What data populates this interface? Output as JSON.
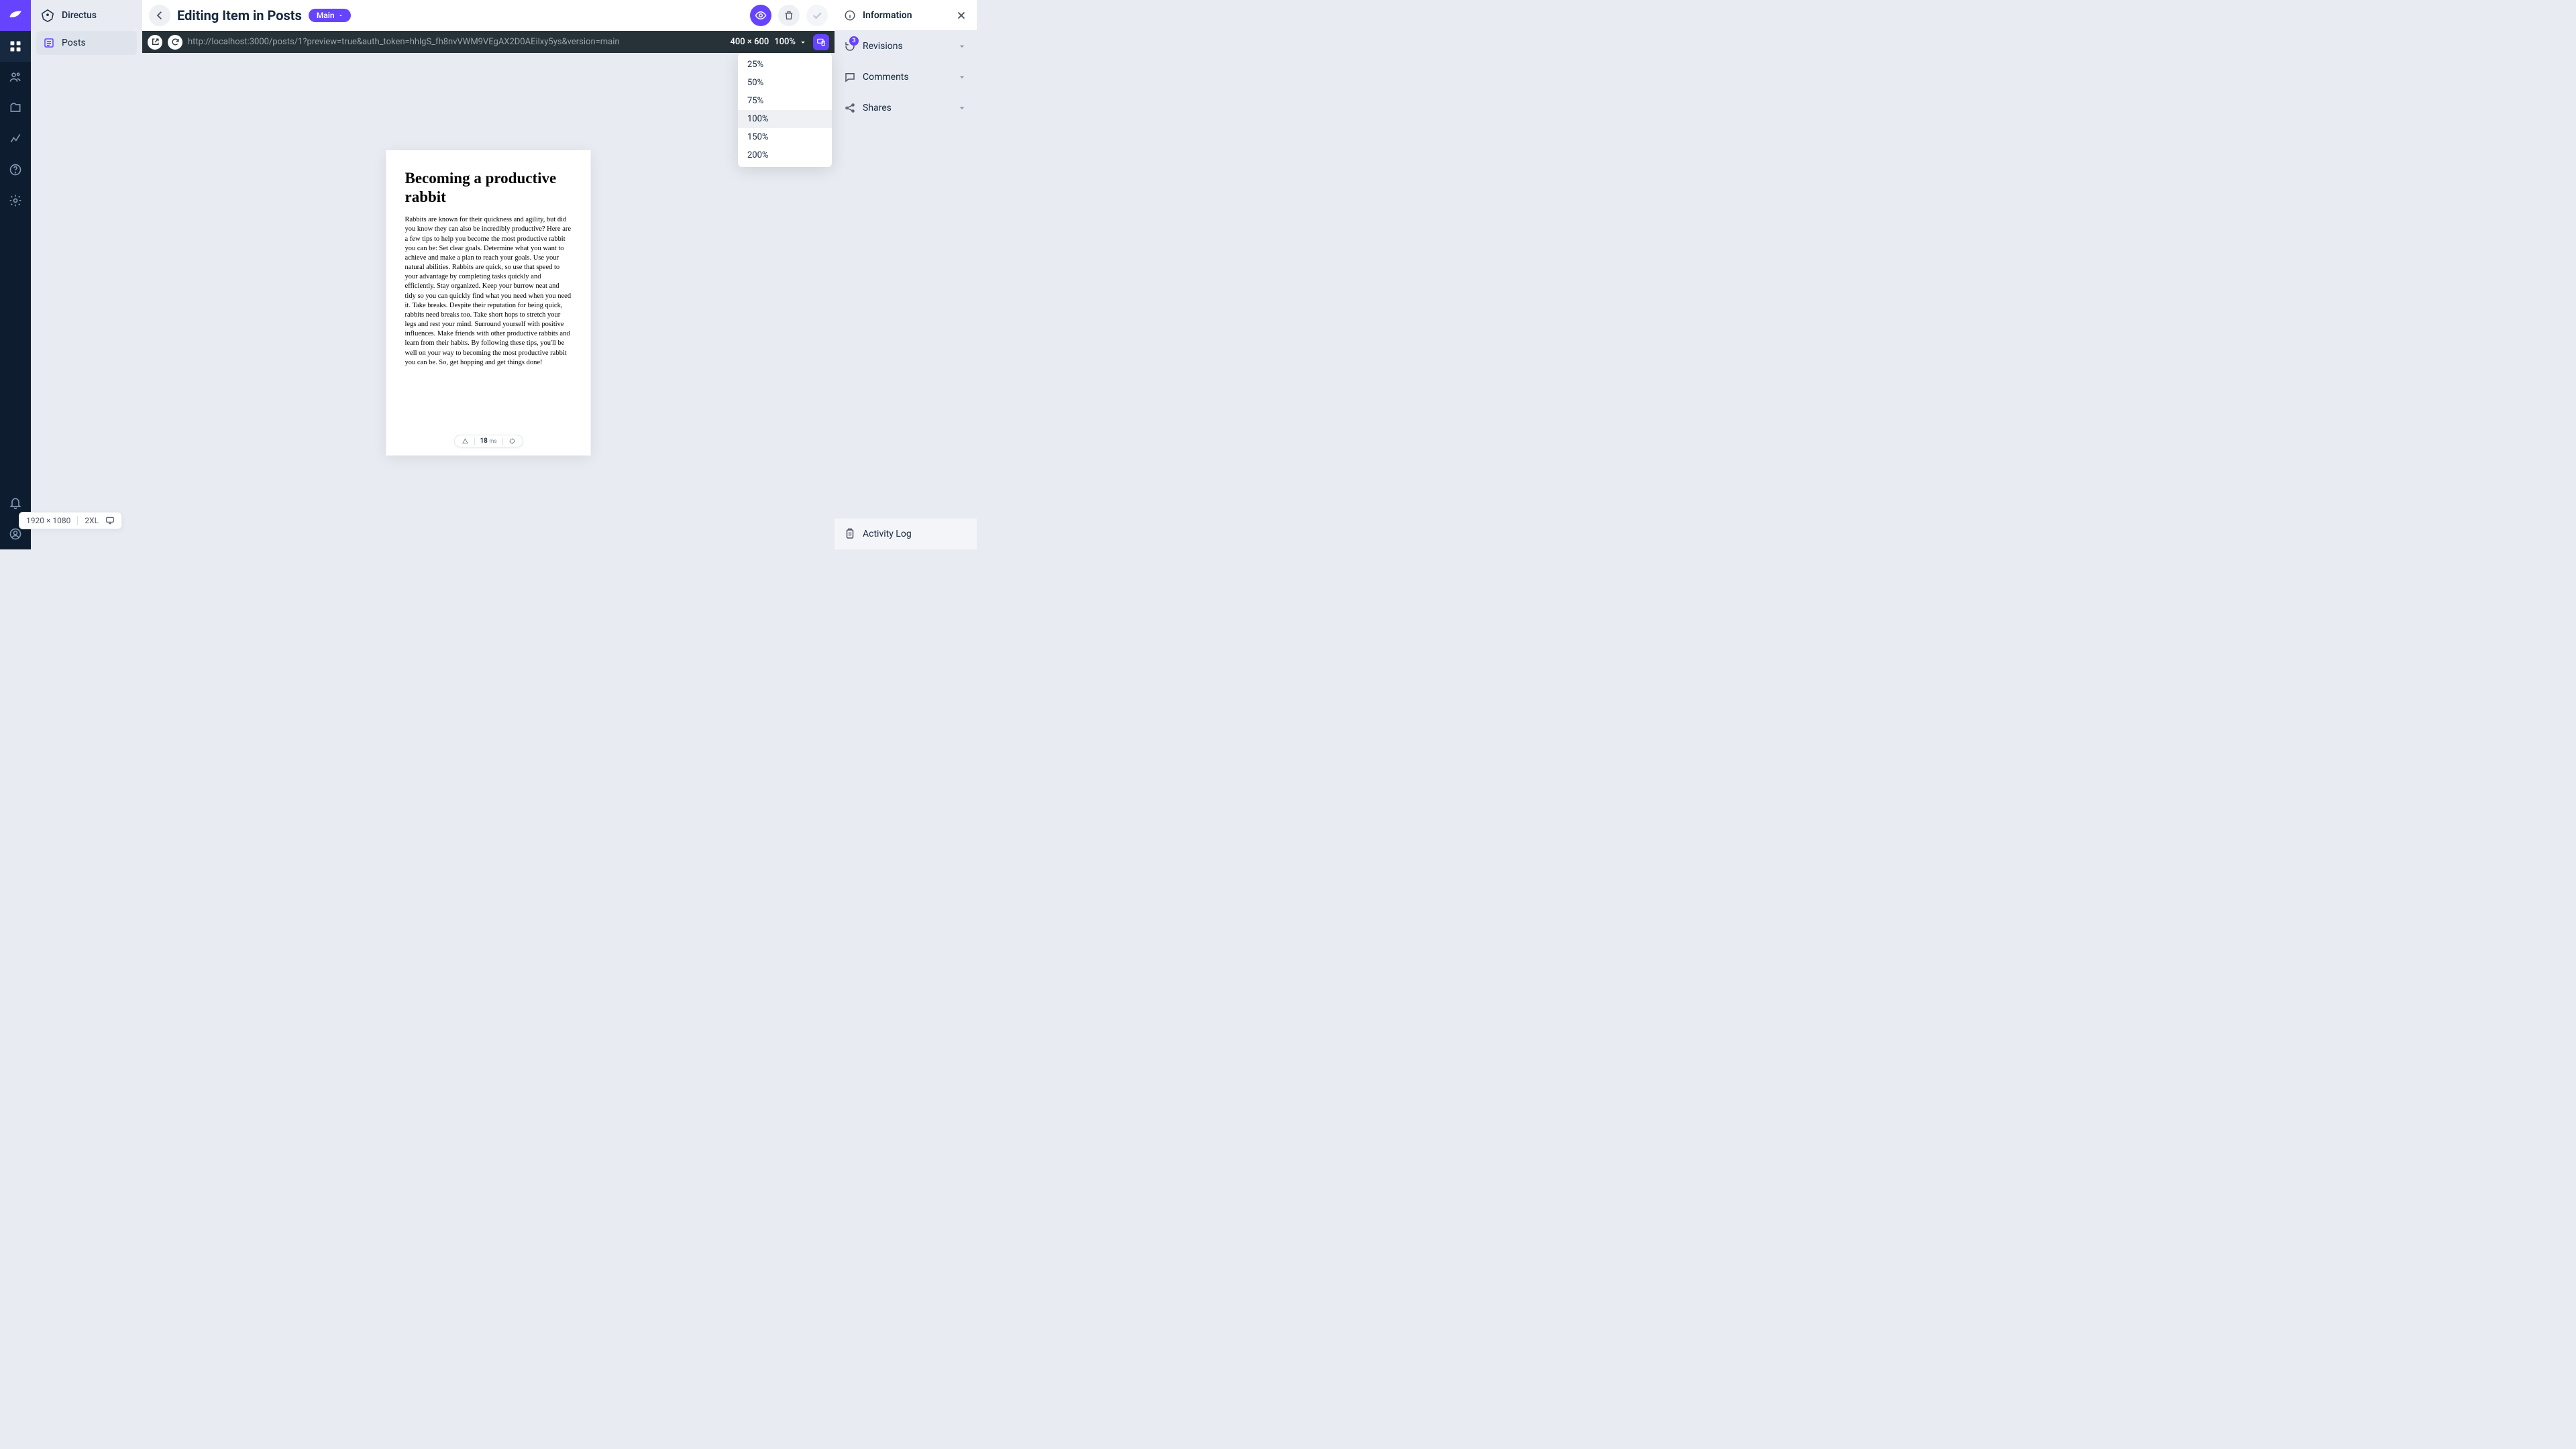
{
  "brand": {
    "name": "Directus"
  },
  "rail": {
    "items": [
      "content",
      "users",
      "files",
      "insights",
      "help",
      "settings"
    ]
  },
  "sidebar": {
    "items": [
      {
        "icon": "post",
        "label": "Posts",
        "active": true
      }
    ]
  },
  "header": {
    "title": "Editing Item in Posts",
    "version_chip": "Main"
  },
  "preview_bar": {
    "url": "http://localhost:3000/posts/1?preview=true&auth_token=hhlgS_fh8nvVWM9VEgAX2D0AEilxy5ys&version=main",
    "dimensions": "400 × 600",
    "zoom_label": "100%"
  },
  "zoom_options": [
    "25%",
    "50%",
    "75%",
    "100%",
    "150%",
    "200%"
  ],
  "zoom_selected": "100%",
  "preview_content": {
    "title": "Becoming a productive rabbit",
    "body": "Rabbits are known for their quickness and agility, but did you know they can also be incredibly productive? Here are a few tips to help you become the most productive rabbit you can be: Set clear goals. Determine what you want to achieve and make a plan to reach your goals. Use your natural abilities. Rabbits are quick, so use that speed to your advantage by completing tasks quickly and efficiently. Stay organized. Keep your burrow neat and tidy so you can quickly find what you need when you need it. Take breaks. Despite their reputation for being quick, rabbits need breaks too. Take short hops to stretch your legs and rest your mind. Surround yourself with positive influences. Make friends with other productive rabbits and learn from their habits. By following these tips, you'll be well on your way to becoming the most productive rabbit you can be. So, get hopping and get things done!",
    "load_ms": "18",
    "load_unit": "ms"
  },
  "right_panel": {
    "header": "Information",
    "sections": {
      "revisions": {
        "label": "Revisions",
        "badge": "3"
      },
      "comments": {
        "label": "Comments"
      },
      "shares": {
        "label": "Shares"
      }
    },
    "footer": "Activity Log"
  },
  "viewport_pill": {
    "size": "1920 × 1080",
    "bp": "2XL"
  }
}
